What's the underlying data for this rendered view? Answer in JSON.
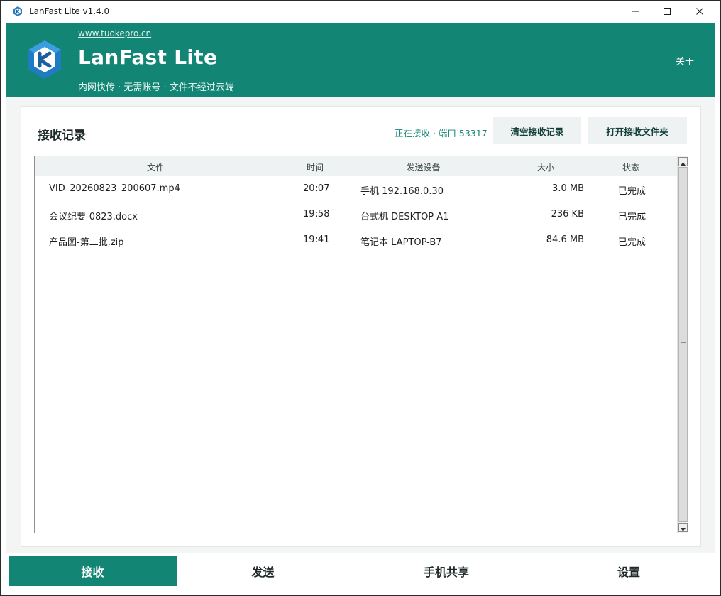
{
  "window": {
    "title": "LanFast Lite v1.4.0",
    "controls": [
      "minimize",
      "maximize",
      "close"
    ]
  },
  "header": {
    "site_link": "www.tuokepro.cn",
    "title": "LanFast Lite",
    "subtitle": "内网快传 · 无需账号 · 文件不经过云端",
    "about": "关于",
    "brand_color": "#128575"
  },
  "panel": {
    "title": "接收记录",
    "status": "正在接收 · 端口 53317",
    "clear_button": "清空接收记录",
    "open_folder_button": "打开接收文件夹"
  },
  "table": {
    "columns": [
      "文件",
      "时间",
      "发送设备",
      "大小",
      "状态"
    ],
    "rows": [
      {
        "file": "VID_20260823_200607.mp4",
        "time": "20:07",
        "device": "手机 192.168.0.30",
        "size": "3.0 MB",
        "status": "已完成"
      },
      {
        "file": "会议纪要-0823.docx",
        "time": "19:58",
        "device": "台式机 DESKTOP-A1",
        "size": "236 KB",
        "status": "已完成"
      },
      {
        "file": "产品图-第二批.zip",
        "time": "19:41",
        "device": "笔记本 LAPTOP-B7",
        "size": "84.6 MB",
        "status": "已完成"
      }
    ]
  },
  "nav": {
    "items": [
      {
        "label": "接收",
        "active": true
      },
      {
        "label": "发送",
        "active": false
      },
      {
        "label": "手机共享",
        "active": false
      },
      {
        "label": "设置",
        "active": false
      }
    ]
  }
}
